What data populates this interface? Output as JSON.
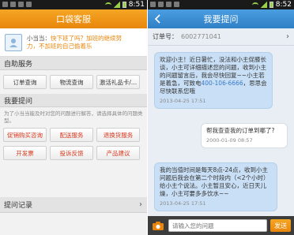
{
  "left": {
    "status_time": "8:51",
    "title": "口袋客服",
    "mascot": {
      "name": "小当当：",
      "line1": "快下班了吗？加班的继续努",
      "line2": "力，不加班的自己偷着乐"
    },
    "self_service": {
      "header": "自助服务",
      "buttons": [
        "订单查询",
        "物流查询",
        "激活礼品卡/..."
      ]
    },
    "ask": {
      "header": "我要提问",
      "desc": "为了小当当能及时对您的问题进行解答，请选择具体的问题类型。",
      "buttons": [
        "促销购买咨询",
        "配送服务",
        "退换货服务",
        "开发票",
        "投诉反馈",
        "产品建议"
      ]
    },
    "history": {
      "header": "提问记录"
    }
  },
  "right": {
    "status_time": "8:52",
    "title": "我要提问",
    "order": {
      "label": "订单号：",
      "number": "6002771041"
    },
    "messages": [
      {
        "from": "agent",
        "text_a": "欢迎小主！近日暑忙，没法和小主促膝长谈，小主可详细描述您的问题，收到小主的问题留言后，我会尽快回复~~小主若是着急，可致电",
        "phone": "400-106-6666",
        "text_b": "，思思会尽快联系您哦",
        "time": "2013-04-25 17:51"
      },
      {
        "from": "user",
        "text": "帮我查查我的订单到哪了?",
        "time": "2000-01-09 08:57"
      },
      {
        "from": "agent",
        "text": "我的当值时间是每天8点-24点，收到小主问题后我会在第二个时段内（<2个小时）给小主个说法。小主暂且安心，近日天儿燥，小主可要多多饮水~~",
        "time": "2013-04-25 17:51"
      }
    ],
    "input": {
      "placeholder": "请输入您的问题",
      "send_label": "发送"
    }
  },
  "colors": {
    "orange": "#e8860c",
    "blue": "#2f7fc5",
    "bubble_agent": "#c9dff5"
  }
}
